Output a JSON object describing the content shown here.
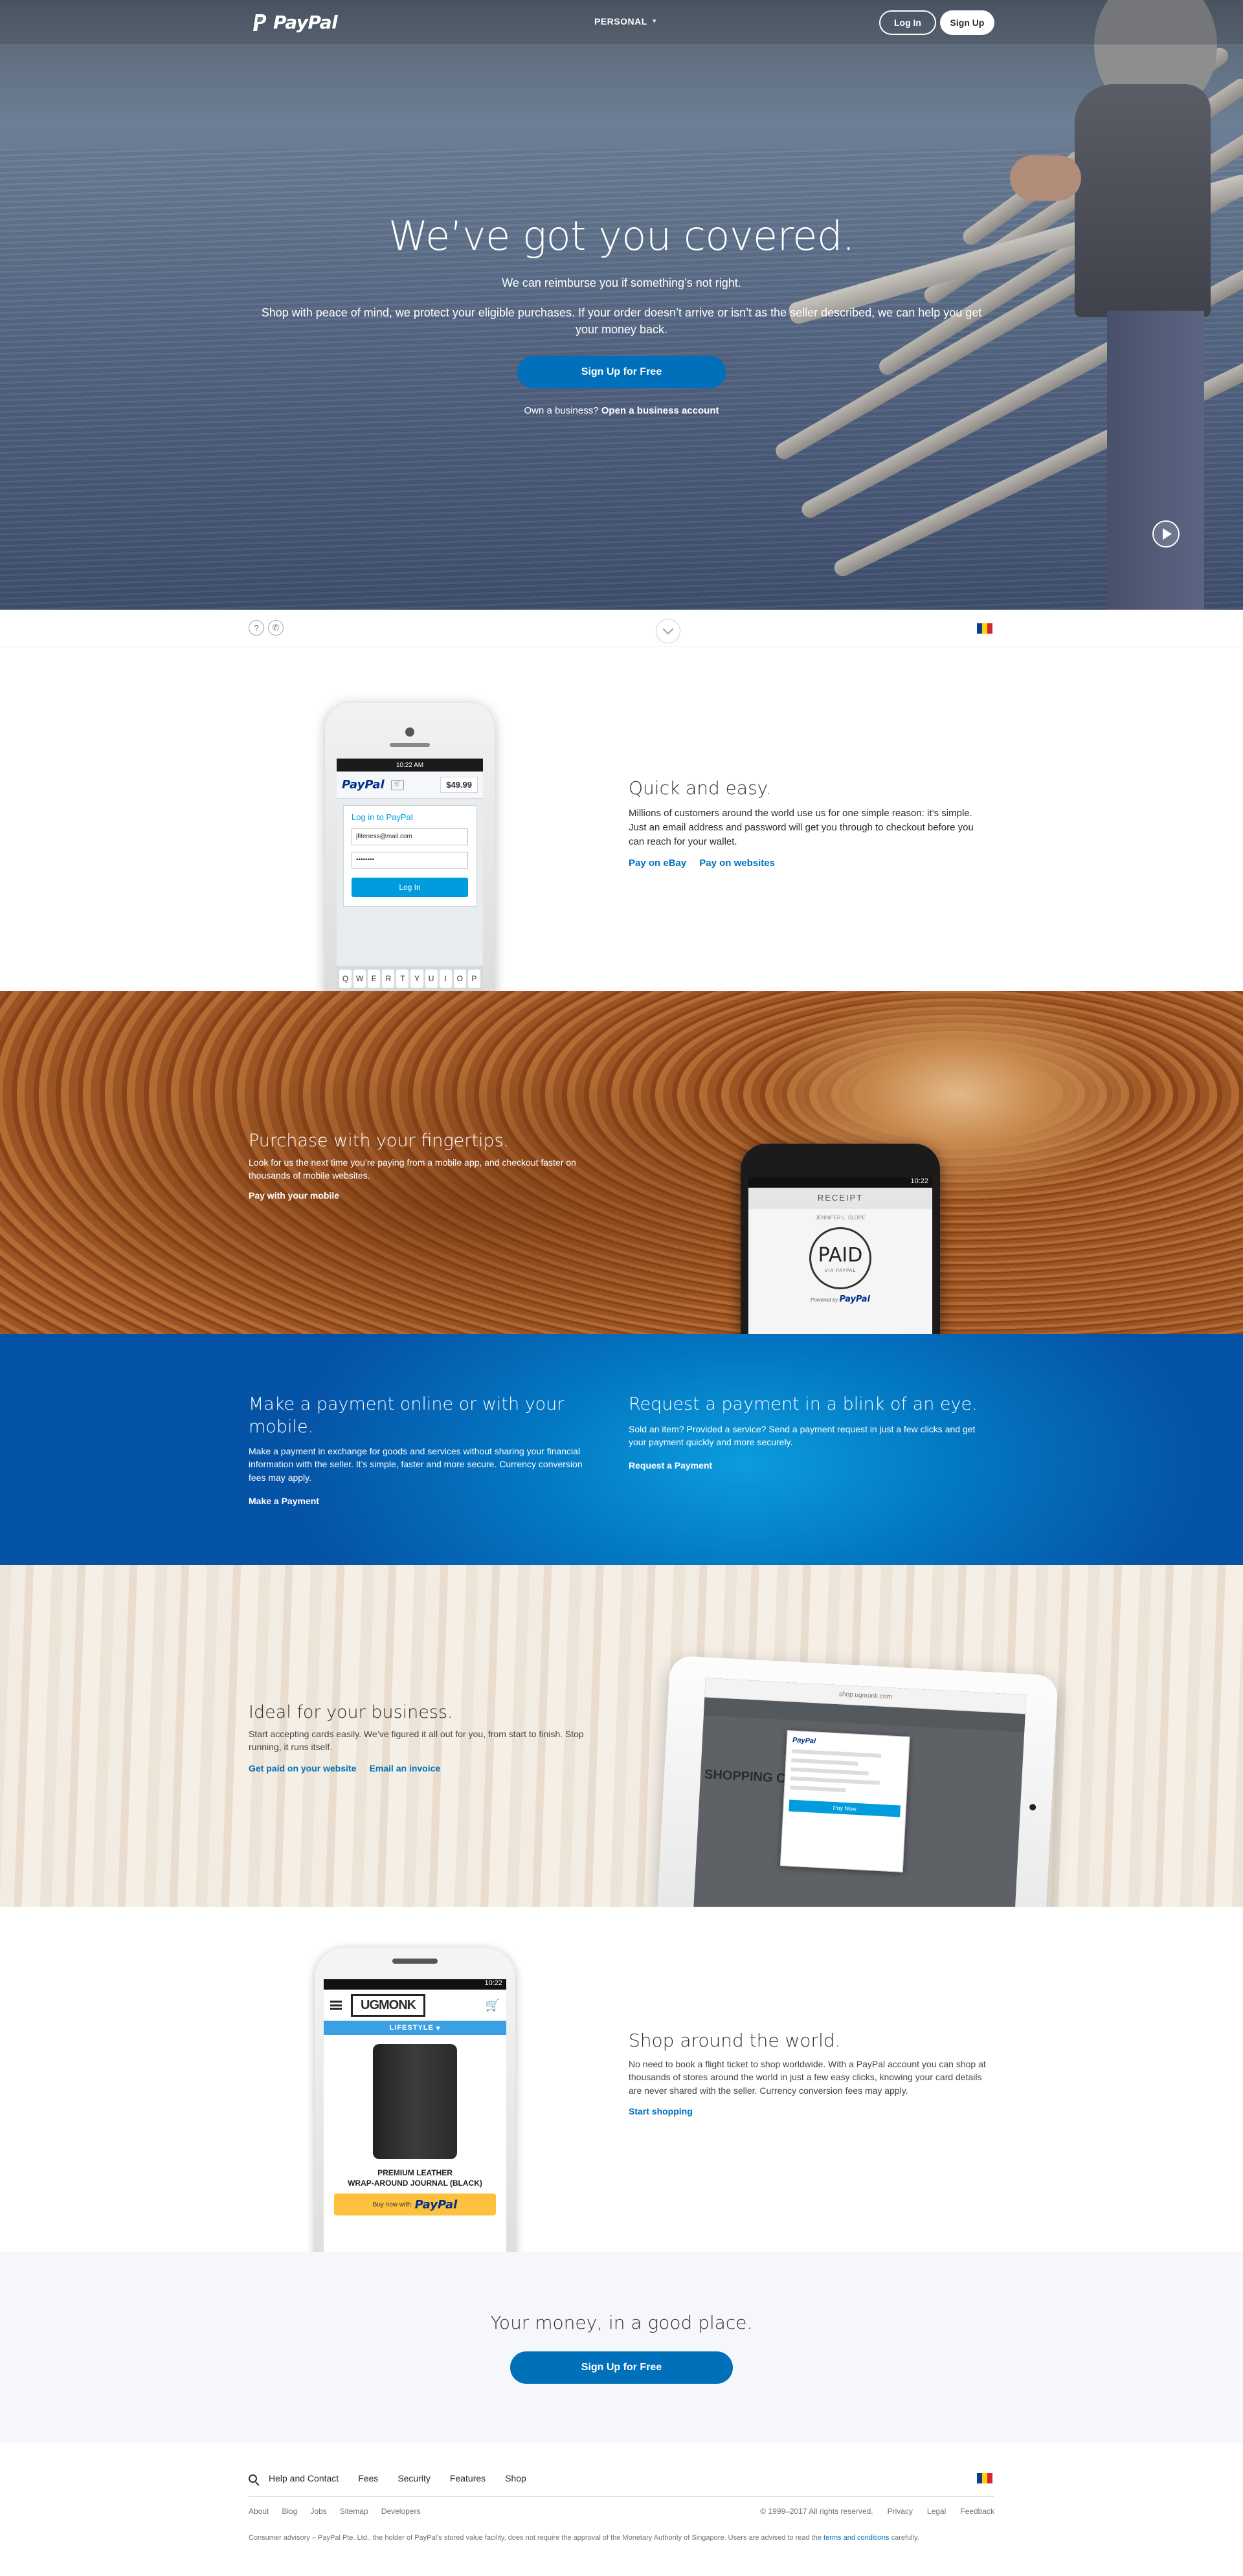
{
  "brand": {
    "name": "PayPal"
  },
  "nav": {
    "personal_label": "PERSONAL",
    "login_label": "Log In",
    "signup_label": "Sign Up"
  },
  "hero": {
    "title": "We’ve got you covered.",
    "subtitle": "We can reimburse you if something’s not right.",
    "description": "Shop with peace of mind, we protect your eligible purchases. If your order doesn’t arrive or isn’t as the seller described, we can help you get your money back.",
    "cta_label": "Sign Up for Free",
    "business_prefix": "Own a business?",
    "business_link": "Open a business account"
  },
  "util": {
    "help_glyph": "?",
    "contact_glyph": "✆"
  },
  "quick": {
    "title": "Quick and easy.",
    "text": "Millions of customers around the world use us for one simple reason: it’s simple. Just an email address and password will get you through to checkout before you can reach for your wallet.",
    "links": [
      "Pay on eBay",
      "Pay on websites"
    ],
    "phone": {
      "time": "10:22 AM",
      "logo": "PayPal",
      "amount": "$49.99",
      "form_title": "Log in to PayPal",
      "email": "jfiteness@mail.com",
      "password": "••••••••",
      "login": "Log In",
      "keys": [
        "Q",
        "W",
        "E",
        "R",
        "T",
        "Y",
        "U",
        "I",
        "O",
        "P"
      ]
    }
  },
  "wood": {
    "title": "Purchase with your fingertips.",
    "text": "Look for us the next time you’re paying from a mobile app, and checkout faster on thousands of mobile websites.",
    "link": "Pay with your mobile",
    "phone": {
      "time": "10:22",
      "receipt": "RECEIPT",
      "merchant": "JENNIFER L. SLOPE",
      "paid": "PAID",
      "paid_sub": "VIA PAYPAL",
      "footer_prefix": "Powered by",
      "footer_logo": "PayPal"
    }
  },
  "blue": {
    "left": {
      "title": "Make a payment online or with your mobile.",
      "text": "Make a payment in exchange for goods and services without sharing your financial information with the seller. It’s simple, faster and more secure. Currency conversion fees may apply.",
      "link": "Make a Payment"
    },
    "right": {
      "title": "Request a payment in a blink of an eye.",
      "text": "Sold an item? Provided a service? Send a payment request in just a few clicks and get your payment quickly and more securely.",
      "link": "Request a Payment"
    }
  },
  "biz": {
    "title": "Ideal for your business.",
    "text": "Start accepting cards easily. We’ve figured it all out for you, from start to finish. Stop running, it runs itself.",
    "links": [
      "Get paid on your website",
      "Email an invoice"
    ],
    "tablet": {
      "url": "shop.ugmonk.com",
      "modal_logo": "PayPal",
      "pay_label": "Pay Now",
      "shop_label": "SHOPPING CA"
    }
  },
  "world": {
    "title": "Shop around the world.",
    "text": "No need to book a flight ticket to shop worldwide. With a PayPal account you can shop at thousands of stores around the world in just a few easy clicks, knowing your card details are never shared with the seller. Currency conversion fees may apply.",
    "link": "Start shopping",
    "phone": {
      "time": "10:22",
      "brand": "UGMONK",
      "category": "LIFESTYLE",
      "product_line1": "PREMIUM LEATHER",
      "product_line2": "WRAP-AROUND JOURNAL (BLACK)",
      "buy_prefix": "Buy now with",
      "buy_logo": "PayPal"
    }
  },
  "money": {
    "title": "Your money, in a good place.",
    "cta_label": "Sign Up for Free"
  },
  "footer": {
    "nav": [
      "Help and Contact",
      "Fees",
      "Security",
      "Features",
      "Shop"
    ],
    "sub": [
      "About",
      "Blog",
      "Jobs",
      "Sitemap",
      "Developers"
    ],
    "copyright": "© 1999–2017 All rights reserved.",
    "right": [
      "Privacy",
      "Legal",
      "Feedback"
    ],
    "legal_prefix": "Consumer advisory – PayPal Pte. Ltd., the holder of PayPal’s stored value facility, does not require the approval of the Monetary Authority of Singapore. Users are advised to read the",
    "legal_link": "terms and conditions",
    "legal_suffix": "carefully."
  },
  "colors": {
    "primary": "#0070ba",
    "link": "#0070ba",
    "dark": "#2c2e2f",
    "blue_section": "#0379c4"
  },
  "icons": [
    "paypal-logo-icon",
    "chevron-down-icon",
    "help-icon",
    "phone-icon",
    "scroll-down-icon",
    "flag-icon",
    "play-icon",
    "search-icon"
  ]
}
